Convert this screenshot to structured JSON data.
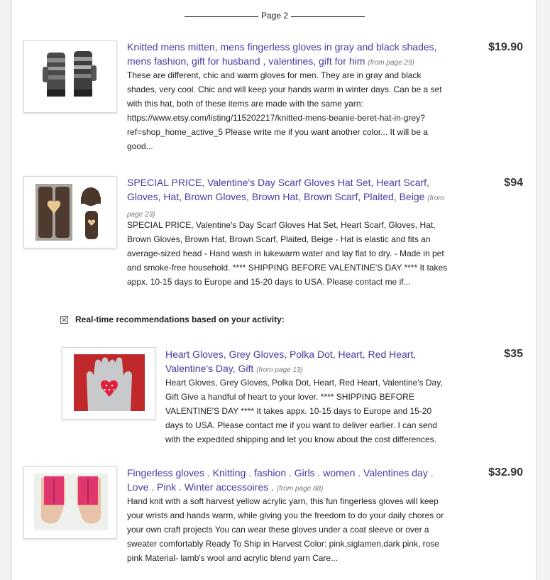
{
  "page_separator": {
    "label": "Page 2"
  },
  "results": [
    {
      "title": "Knitted mens mitten, mens fingerless gloves in gray and black shades, mens fashion, gift for husband , valentines, gift for him",
      "from_page": "(from page 29)",
      "description": "These are different, chic and warm gloves for men. They are in gray and black shades, very cool. Chic and will keep your hands warm in winter days. Can be a set with this hat, both of these items are made with the same yarn: https://www.etsy.com/listing/115202217/knitted-mens-beanie-beret-hat-in-grey?ref=shop_home_active_5 Please write me if you want another color... It will be a good...",
      "price": "$19.90",
      "image_alt": "gray and black fingerless gloves"
    },
    {
      "title": "SPECIAL PRICE, Valentine's Day Scarf Gloves Hat Set, Heart Scarf, Gloves, Hat, Brown Gloves, Brown Hat, Brown Scarf, Plaited, Beige",
      "from_page": "(from page 23)",
      "description": "SPECIAL PRICE, Valentine's Day Scarf Gloves Hat Set, Heart Scarf, Gloves, Hat, Brown Gloves, Brown Hat, Brown Scarf, Plaited, Beige - Hat is elastic and fits an average-sized head - Hand wash in lukewarm water and lay flat to dry. - Made in pet and smoke-free household. **** SHIPPING BEFORE VALENTINE'S DAY **** It takes appx. 10-15 days to Europe and 15-20 days to USA. Please contact me if...",
      "price": "$94",
      "image_alt": "brown gloves hat scarf set"
    }
  ],
  "recommendations": {
    "heading": "Real-time recommendations based on your activity:",
    "close_icon": "close-x-icon",
    "items": [
      {
        "title": "Heart Gloves, Grey Gloves, Polka Dot, Heart, Red Heart, Valentine's Day, Gift",
        "from_page": "(from page 13)",
        "description": "Heart Gloves, Grey Gloves, Polka Dot, Heart, Red Heart, Valentine's Day, Gift Give a handful of heart to your lover. **** SHIPPING BEFORE VALENTINE'S DAY **** It takes appx. 10-15 days to Europe and 15-20 days to USA. Please contact me if you want to deliver earlier. I can send with the expedited shipping and let you know about the cost differences.",
        "price": "$35",
        "image_alt": "grey gloves with red heart"
      }
    ]
  },
  "more_results": [
    {
      "title": "Fingerless gloves . Knitting . fashion . Girls . women . Valentines day . Love . Pink . Winter accessoires .",
      "from_page": "(from page 88)",
      "description": "Hand knit with a soft harvest yellow acrylic yarn, this fun fingerless gloves will keep your wrists and hands warm, while giving you the freedom to do your daily chores or your own craft projects You can wear these gloves under a coat sleeve or over a sweater comfortably Ready To Ship in Harvest Color: pink,siglamen,dark pink, rose pink Material- lamb's wool and acrylic blend yarn Care...",
      "price": "$32.90",
      "image_alt": "pink fingerless gloves"
    }
  ],
  "colors": {
    "link": "#4a3a9c",
    "price": "#333333",
    "heart_red": "#d9202e"
  }
}
